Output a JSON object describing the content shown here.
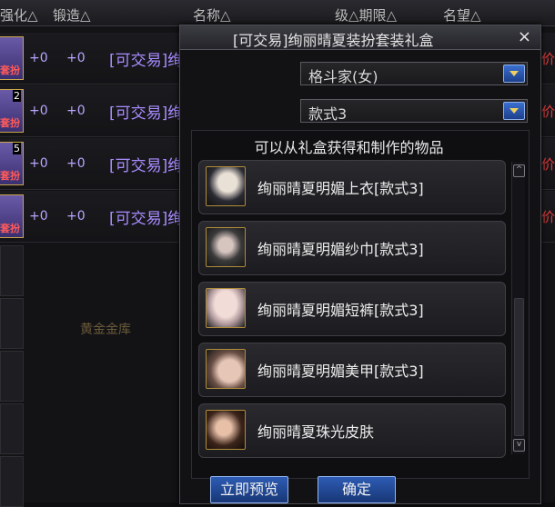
{
  "background": {
    "headers": {
      "strengthen": "强化△",
      "forge": "锻造△",
      "name": "名称△",
      "level_limit": "级△期限△",
      "reputation": "名望△"
    },
    "rows": [
      {
        "count": "",
        "tag": "套扮",
        "strengthen": "+0",
        "forge": "+0",
        "name": "[可交易]绚丽晴夏装扮套装",
        "right": "售价"
      },
      {
        "count": "2",
        "tag": "套扮",
        "strengthen": "+0",
        "forge": "+0",
        "name": "[可交易]绚丽晴夏装扮套装",
        "right": "售价"
      },
      {
        "count": "5",
        "tag": "套扮",
        "strengthen": "+0",
        "forge": "+0",
        "name": "[可交易]绚丽晴夏装扮套装",
        "right": "售价"
      },
      {
        "count": "",
        "tag": "套扮",
        "strengthen": "+0",
        "forge": "+0",
        "name": "[可交易]绚丽晴夏装扮套装",
        "right": "售价"
      }
    ],
    "gold_label": "黄金金库"
  },
  "dialog": {
    "title": "[可交易]绚丽晴夏装扮套装礼盒",
    "close": "×",
    "class_select": "格斗家(女)",
    "style_select": "款式3",
    "list_heading": "可以从礼盒获得和制作的物品",
    "items": [
      {
        "label": "绚丽晴夏明媚上衣[款式3]",
        "icon": "top-clothing-icon"
      },
      {
        "label": "绚丽晴夏明媚纱巾[款式3]",
        "icon": "scarf-icon"
      },
      {
        "label": "绚丽晴夏明媚短裤[款式3]",
        "icon": "shorts-icon"
      },
      {
        "label": "绚丽晴夏明媚美甲[款式3]",
        "icon": "nails-icon"
      },
      {
        "label": "绚丽晴夏珠光皮肤",
        "icon": "skin-icon"
      }
    ],
    "scroll_up": "^",
    "scroll_down": "v",
    "preview_button": "立即预览",
    "confirm_button": "确定"
  },
  "colors": {
    "item_purple": "#a98cff",
    "price_red": "#e03a3a",
    "button_blue": "#2e5cb4"
  }
}
